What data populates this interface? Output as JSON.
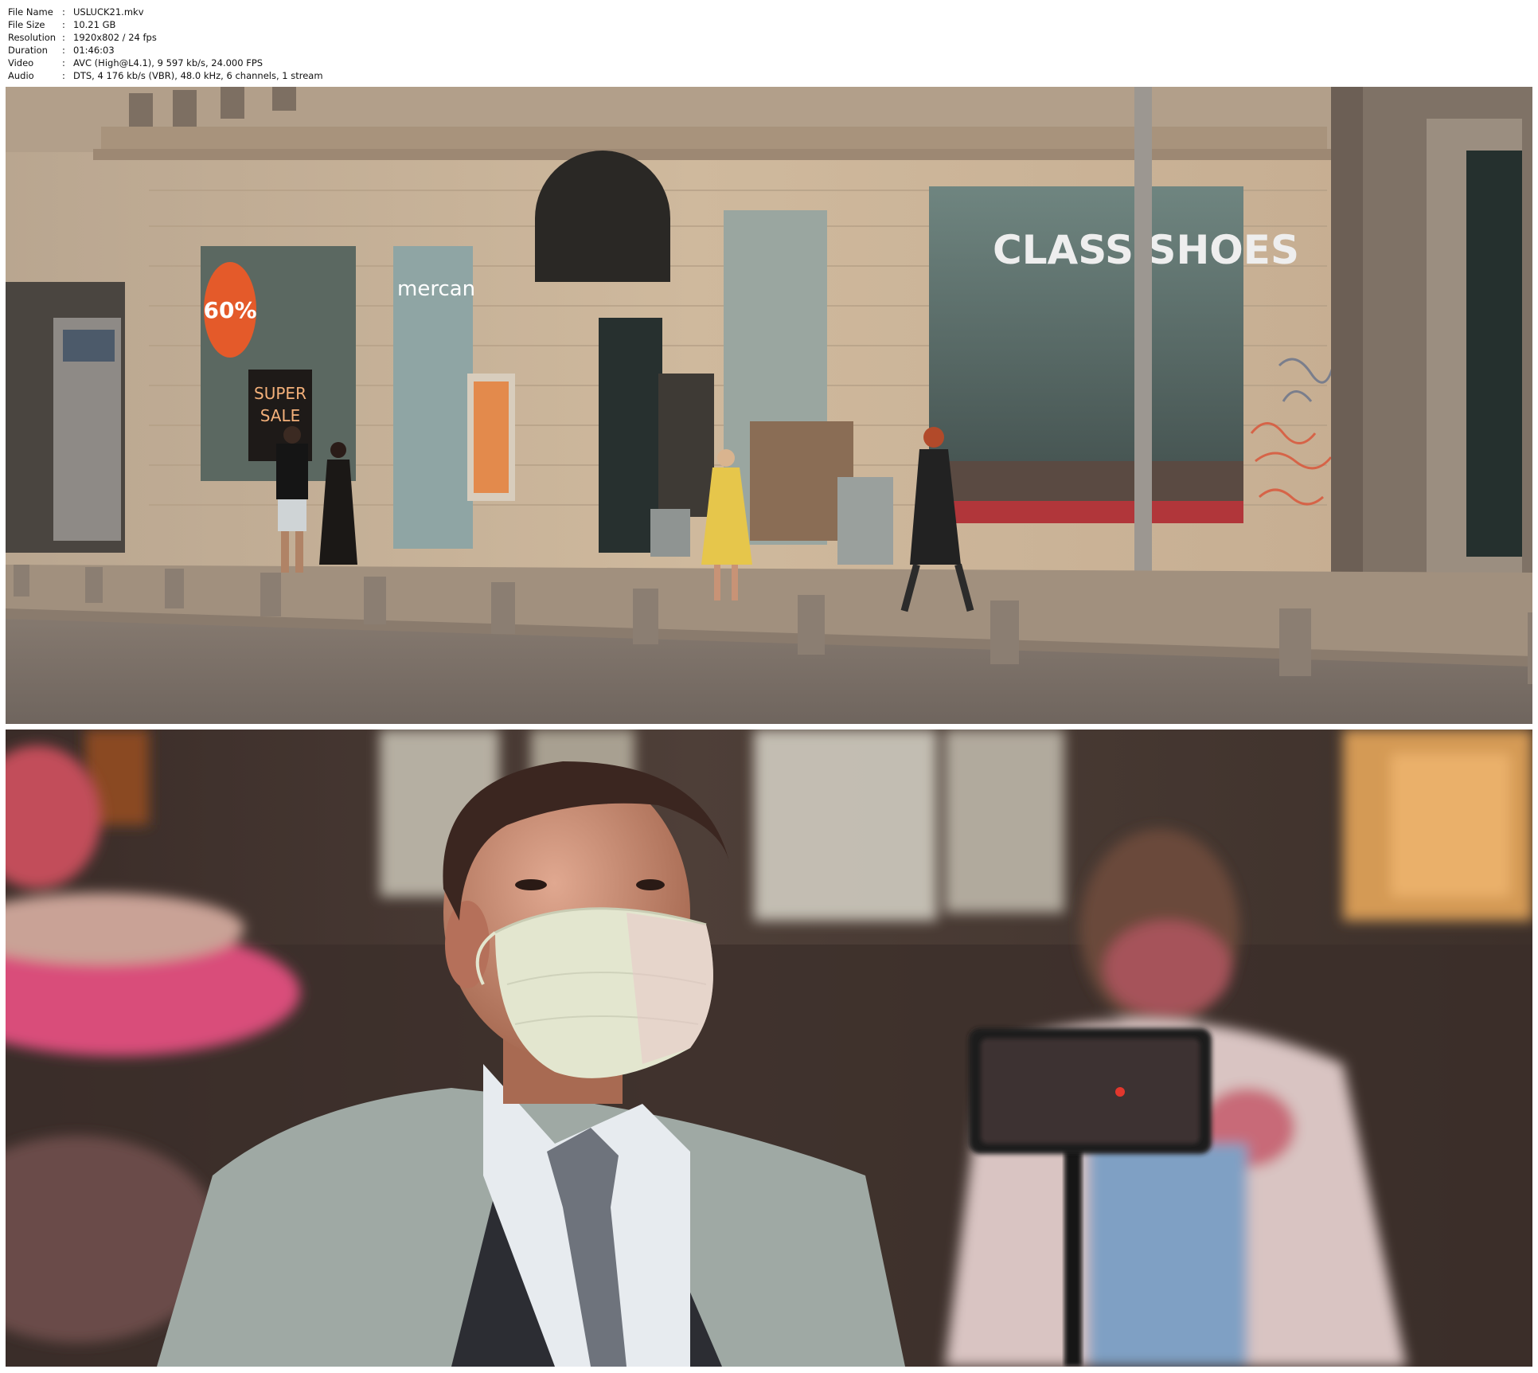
{
  "file_info": [
    {
      "key": "File Name",
      "value": "USLUCK21.mkv"
    },
    {
      "key": "File Size",
      "value": "10.21 GB"
    },
    {
      "key": "Resolution",
      "value": "1920x802 / 24 fps"
    },
    {
      "key": "Duration",
      "value": "01:46:03"
    },
    {
      "key": "Video",
      "value": "AVC (High@L4.1), 9 597 kb/s, 24.000 FPS"
    },
    {
      "key": "Audio",
      "value": "DTS, 4 176 kb/s (VBR), 48.0 kHz, 6 channels, 1 stream"
    }
  ],
  "frames": {
    "street": {
      "shop_sign": "CLASS SHOES",
      "sale_text_1": "SUPER",
      "sale_text_2": "SALE",
      "promo_badge": "60%",
      "brand_sign": "mercan"
    },
    "portrait": {}
  },
  "colors": {
    "facade": "#c9b49a",
    "sidewalk": "#a1907e",
    "road": "#7c7068",
    "warm_bokeh": "#d9a35a",
    "jacket": "#9fa9a4",
    "mask": "#e3e6cf"
  }
}
